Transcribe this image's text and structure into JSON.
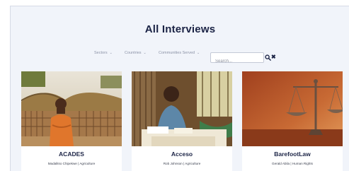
{
  "page": {
    "title": "All Interviews"
  },
  "filters": {
    "sectors": "Sectors",
    "countries": "Countries",
    "communities": "Communities Served",
    "search_placeholder": "Search..."
  },
  "icons": {
    "search": "search-icon",
    "clear": "close-icon",
    "dropdown": "chevron-down-icon"
  },
  "cards": [
    {
      "name": "ACADES",
      "meta": "Madalitso Chipekwe | Agriculture"
    },
    {
      "name": "Acceso",
      "meta": "Rob Johnson | Agriculture"
    },
    {
      "name": "BarefootLaw",
      "meta": "Gerald Abila | Human Rights"
    }
  ],
  "colors": {
    "background": "#f1f4fa",
    "heading": "#1b2345",
    "card": "#ffffff"
  }
}
